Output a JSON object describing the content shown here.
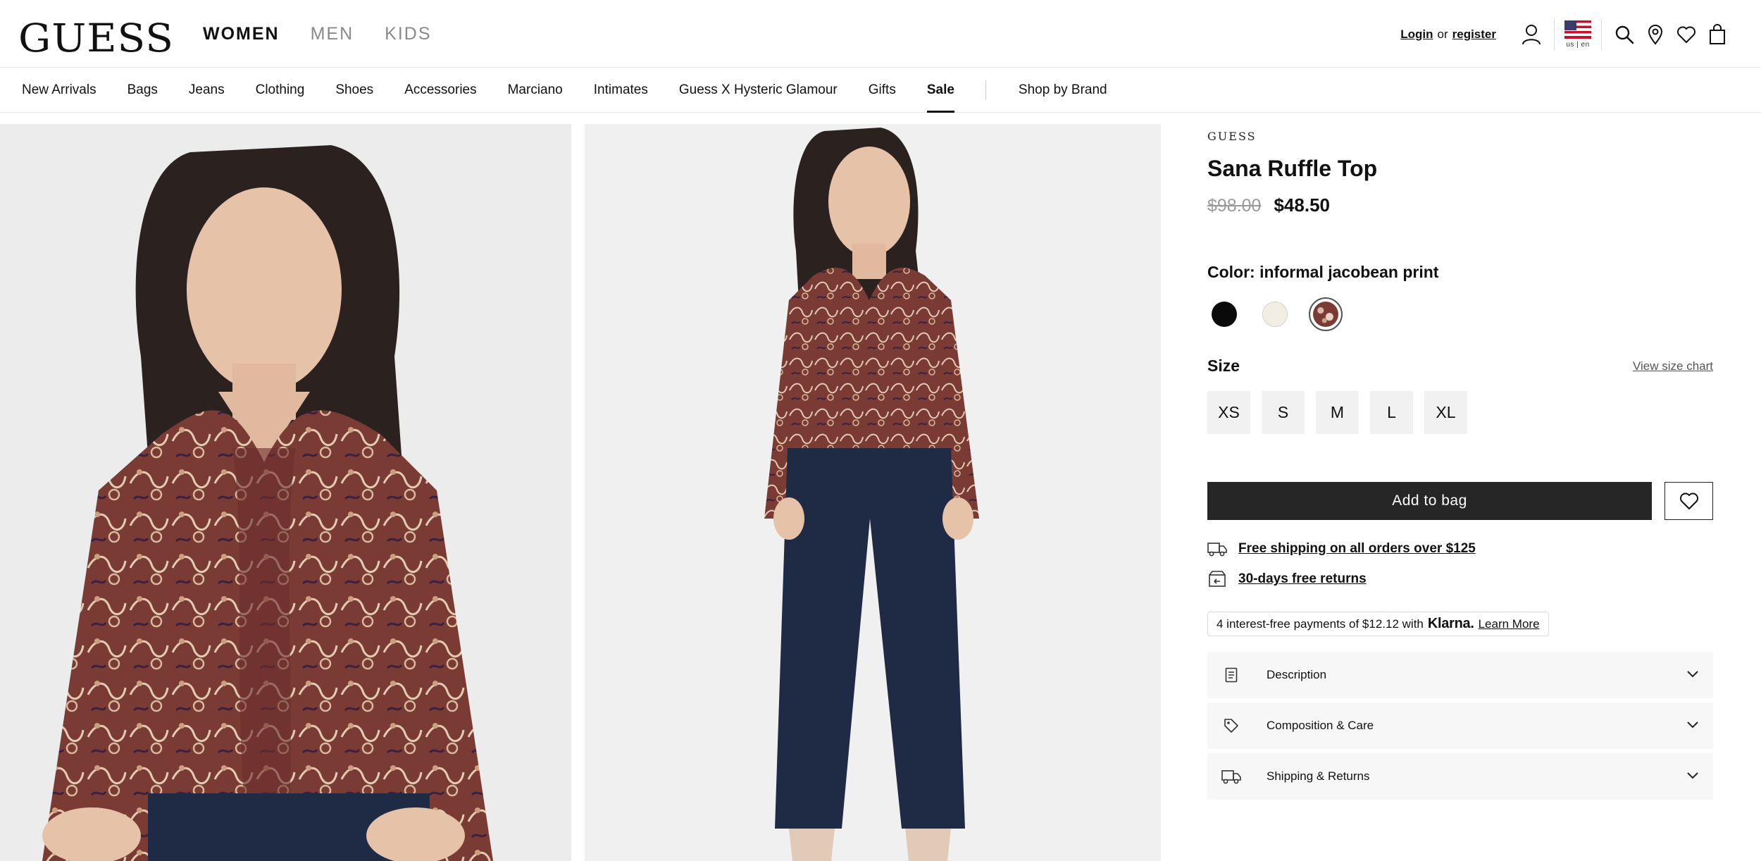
{
  "header": {
    "logo": "GUESS",
    "gender_tabs": [
      "WOMEN",
      "MEN",
      "KIDS"
    ],
    "login_label": "Login",
    "or_label": "or",
    "register_label": "register",
    "locale_label": "us | en"
  },
  "categories": [
    "New Arrivals",
    "Bags",
    "Jeans",
    "Clothing",
    "Shoes",
    "Accessories",
    "Marciano",
    "Intimates",
    "Guess X Hysteric Glamour",
    "Gifts",
    "Sale",
    "Shop by Brand"
  ],
  "product": {
    "brand": "GUESS",
    "title": "Sana Ruffle Top",
    "original_price": "$98.00",
    "sale_price": "$48.50",
    "color_prefix": "Color:",
    "color_value": "informal jacobean print",
    "swatches": [
      {
        "name": "black",
        "color": "#0a0a0a"
      },
      {
        "name": "cream",
        "color": "#f3eee4"
      },
      {
        "name": "informal jacobean print",
        "color": "#7a3b35"
      }
    ],
    "size_label": "Size",
    "size_chart_label": "View size chart",
    "sizes": [
      "XS",
      "S",
      "M",
      "L",
      "XL"
    ],
    "add_to_bag_label": "Add to bag",
    "shipping_perk": "Free shipping on all orders over $125",
    "returns_perk": "30-days free returns",
    "klarna_text": "4 interest-free payments of $12.12 with",
    "klarna_brand": "Klarna.",
    "klarna_link": "Learn More",
    "accordion": [
      "Description",
      "Composition & Care",
      "Shipping & Returns"
    ]
  },
  "colors": {
    "accent_dark": "#262626",
    "top_print": "#7a3b35",
    "denim": "#1f2a44"
  }
}
